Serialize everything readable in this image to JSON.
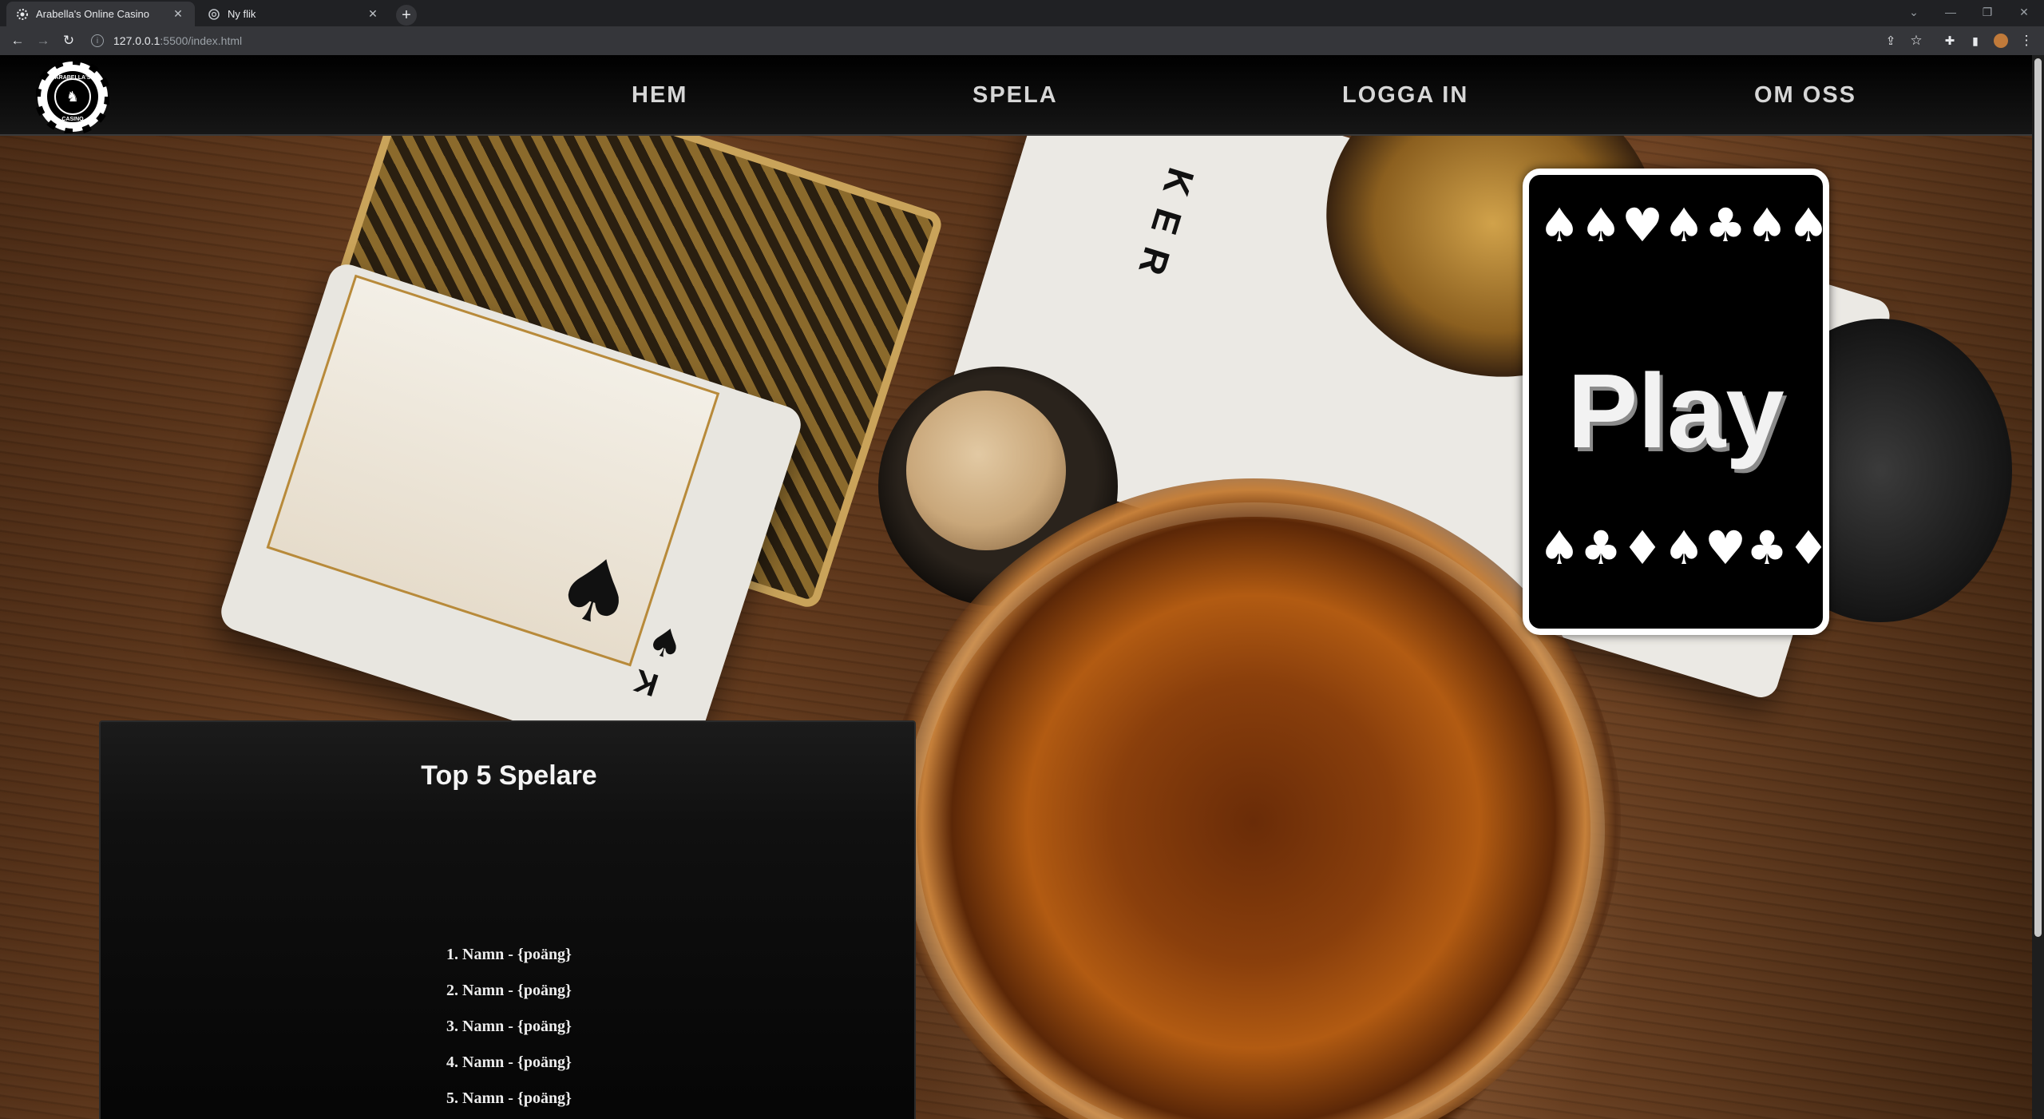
{
  "browser": {
    "tabs": [
      {
        "title": "Arabella's Online Casino",
        "icon": "casino-chip-icon",
        "active": true
      },
      {
        "title": "Ny flik",
        "icon": "chrome-icon",
        "active": false
      }
    ],
    "url_host": "127.0.0.1",
    "url_path": ":5500/index.html"
  },
  "site": {
    "logo_text_top": "ARABELLA'S",
    "logo_text_bottom": "CASINO",
    "nav": {
      "home": "HEM",
      "play": "SPELA",
      "login": "LOGGA IN",
      "about": "OM OSS"
    }
  },
  "play_card": {
    "label": "Play",
    "top_suits": [
      "♠",
      "♠",
      "♥",
      "♠",
      "♣",
      "♠",
      "♠"
    ],
    "bottom_suits": [
      "♠",
      "♣",
      "♦",
      "♠",
      "♥",
      "♣",
      "♦"
    ]
  },
  "leaderboard": {
    "title": "Top 5 Spelare",
    "entries": [
      "1. Namn - {poäng}",
      "2. Namn - {poäng}",
      "3. Namn - {poäng}",
      "4. Namn - {poäng}",
      "5. Namn - {poäng}"
    ]
  },
  "colors": {
    "header_bg": "#0a0a0a",
    "nav_text": "#d6d6d6",
    "card_bg": "#000000",
    "card_border": "#ffffff"
  }
}
